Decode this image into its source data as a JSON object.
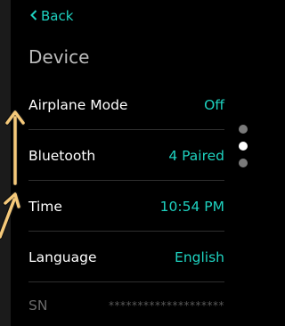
{
  "nav": {
    "back_label": "Back"
  },
  "page": {
    "title": "Device"
  },
  "settings": [
    {
      "label": "Airplane Mode",
      "value": "Off"
    },
    {
      "label": "Bluetooth",
      "value": "4 Paired"
    },
    {
      "label": "Time",
      "value": "10:54 PM"
    },
    {
      "label": "Language",
      "value": "English"
    }
  ],
  "serial": {
    "label": "SN",
    "value": "********************"
  },
  "pager": {
    "page_count": 3,
    "active_index": 1
  },
  "icons": {
    "back": "chevron-left-icon",
    "gesture_up": "arrow-up-icon",
    "gesture_diag": "arrow-diagonal-icon"
  },
  "colors": {
    "accent": "#1ed1bf",
    "background": "#000000",
    "gesture_arrow": "#f5c97a"
  }
}
